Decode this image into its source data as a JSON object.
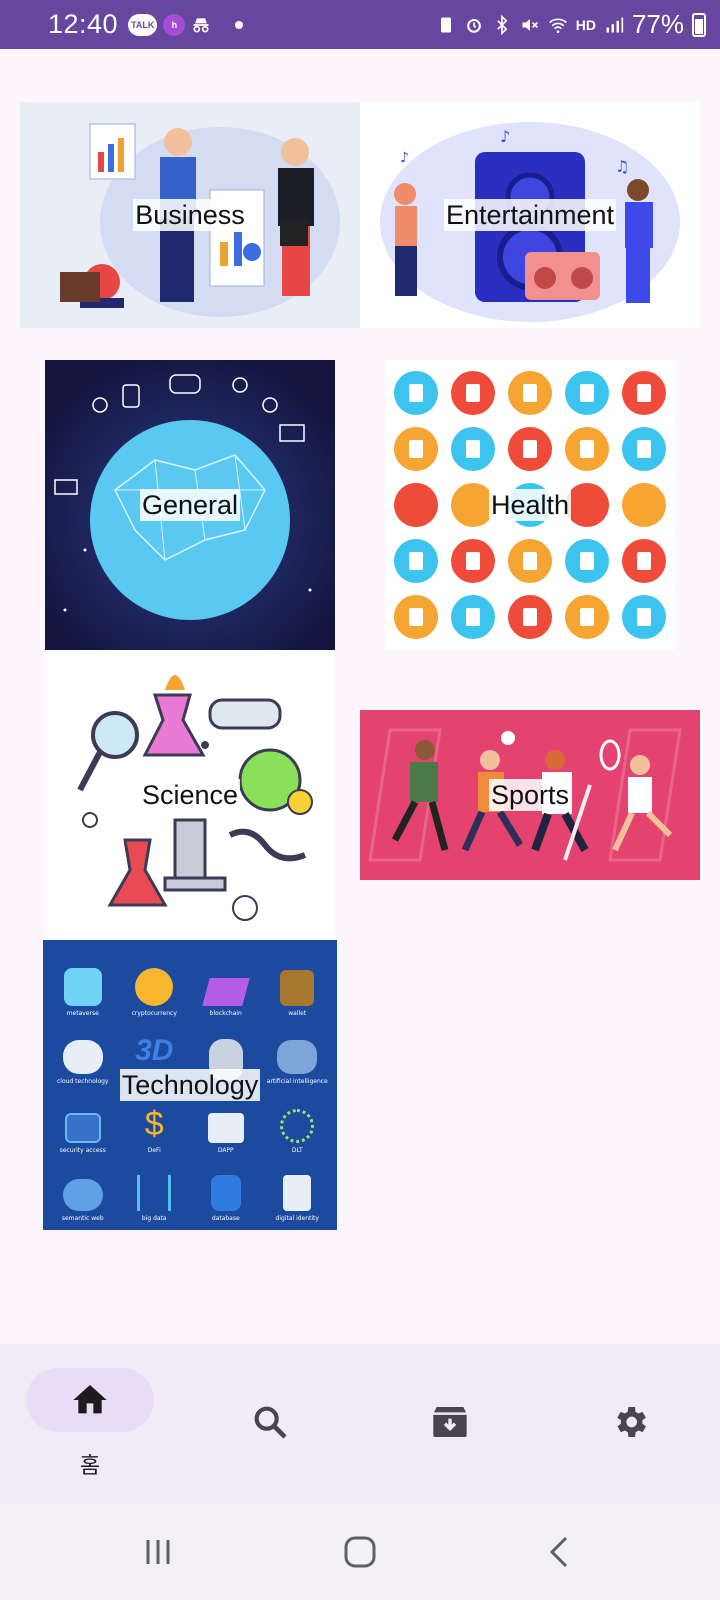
{
  "status_bar": {
    "time": "12:40",
    "badges": [
      "TALK",
      "h"
    ],
    "battery": "77%",
    "network": "HD"
  },
  "tiles": [
    {
      "id": "business",
      "label": "Business",
      "icon": "business-people-illustration"
    },
    {
      "id": "entertainment",
      "label": "Entertainment",
      "icon": "music-speaker-illustration"
    },
    {
      "id": "general",
      "label": "General",
      "icon": "globe-network-illustration"
    },
    {
      "id": "health",
      "label": "Health",
      "icon": "medical-icons-grid-illustration"
    },
    {
      "id": "science",
      "label": "Science",
      "icon": "lab-equipment-illustration"
    },
    {
      "id": "sports",
      "label": "Sports",
      "icon": "athletes-illustration"
    },
    {
      "id": "technology",
      "label": "Technology",
      "icon": "tech-icons-illustration"
    }
  ],
  "technology_icon_labels": [
    "metaverse",
    "cryptocurrency",
    "blockchain",
    "wallet",
    "cloud technology",
    "3D",
    "",
    "artificial intelligence",
    "security access",
    "DeFi",
    "DAPP",
    "DLT",
    "semantic web",
    "big data",
    "database",
    "digital identity"
  ],
  "bottom_nav": {
    "items": [
      {
        "icon": "home-icon",
        "label": "홈",
        "active": true
      },
      {
        "icon": "search-icon",
        "label": "",
        "active": false
      },
      {
        "icon": "archive-icon",
        "label": "",
        "active": false
      },
      {
        "icon": "settings-icon",
        "label": "",
        "active": false
      }
    ]
  },
  "colors": {
    "status_bar": "#66469e",
    "background": "#fdf7fd",
    "nav_background": "#f1ebf5",
    "nav_active_pill": "#e8ddf7",
    "sports_bg": "#e4436f",
    "technology_bg": "#1b4a9f",
    "general_bg": "#1a1c52"
  }
}
